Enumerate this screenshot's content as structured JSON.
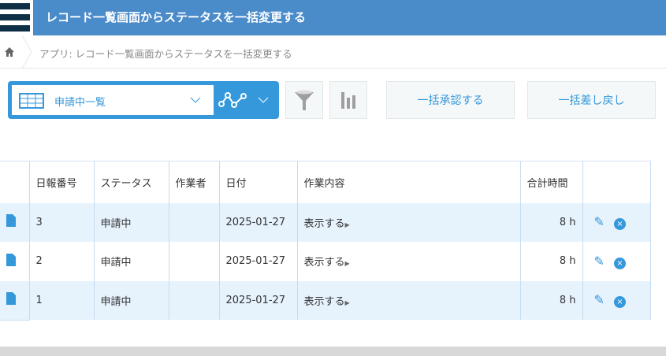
{
  "header": {
    "title": "レコード一覧画面からステータスを一括変更する"
  },
  "breadcrumb": {
    "text": "アプリ: レコード一覧画面からステータスを一括変更する"
  },
  "toolbar": {
    "view_name": "申請中一覧",
    "bulk_approve": "一括承認する",
    "bulk_reject": "一括差し戻し"
  },
  "table": {
    "columns": [
      "日報番号",
      "ステータス",
      "作業者",
      "日付",
      "作業内容",
      "合計時間"
    ],
    "rows": [
      {
        "no": "3",
        "status": "申請中",
        "worker": "",
        "date": "2025-01-27",
        "content": "表示する",
        "hours": "8 h"
      },
      {
        "no": "2",
        "status": "申請中",
        "worker": "",
        "date": "2025-01-27",
        "content": "表示する",
        "hours": "8 h"
      },
      {
        "no": "1",
        "status": "申請中",
        "worker": "",
        "date": "2025-01-27",
        "content": "表示する",
        "hours": "8 h"
      }
    ]
  },
  "colors": {
    "header": "#4a8bc9",
    "accent": "#3498db",
    "row_alt": "#e6f2fc"
  }
}
